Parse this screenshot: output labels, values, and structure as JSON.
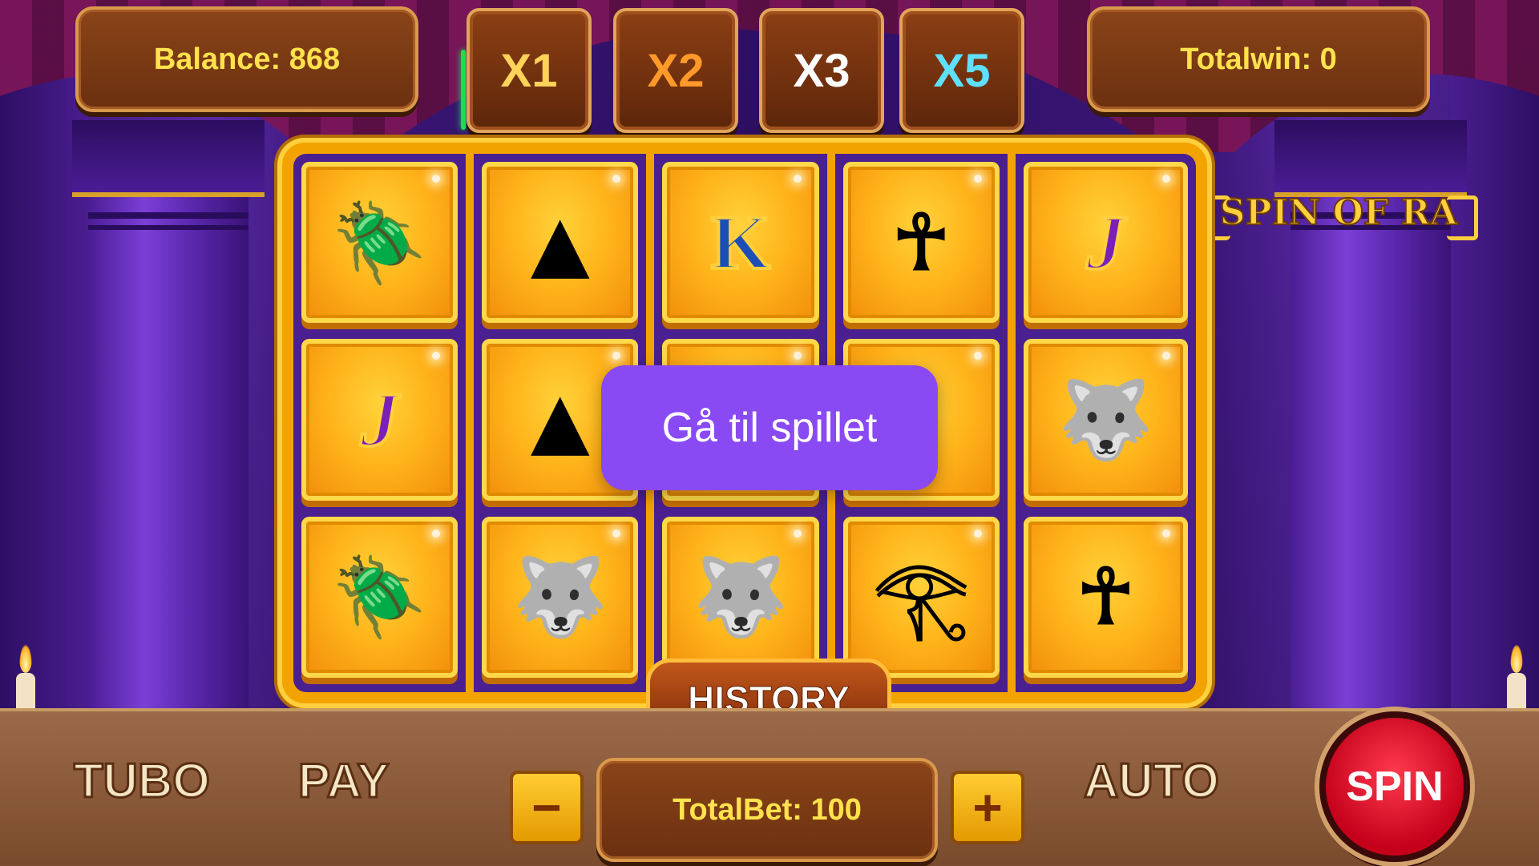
{
  "game": {
    "logo": "SPIN OF RA"
  },
  "top": {
    "balance": "Balance: 868",
    "totalwin": "Totalwin: 0",
    "multipliers": [
      "X1",
      "X2",
      "X3",
      "X5"
    ]
  },
  "reels": [
    [
      "scarab",
      "J",
      "scarab"
    ],
    [
      "pyramid",
      "pyramid",
      "anubis"
    ],
    [
      "K",
      "",
      "anubis"
    ],
    [
      "ankh",
      "",
      "eye-of-horus"
    ],
    [
      "J",
      "anubis",
      "ankh"
    ]
  ],
  "symbols": {
    "K": "K",
    "J": "J",
    "scarab": "🪲",
    "pyramid": "▲",
    "ankh": "☥",
    "anubis": "🐺",
    "eye-of-horus": "𓂀"
  },
  "overlay": {
    "goto_label": "Gå til spillet"
  },
  "history_label": "HISTORY",
  "bottom": {
    "tubo": "TUBO",
    "pay": "PAY",
    "minus": "−",
    "totalbet": "TotalBet: 100",
    "plus": "+",
    "auto": "AUTO",
    "spin": "SPIN"
  },
  "colors": {
    "accent": "#8a4af3",
    "gold": "#ffe24d",
    "spin_red": "#e0102a"
  }
}
